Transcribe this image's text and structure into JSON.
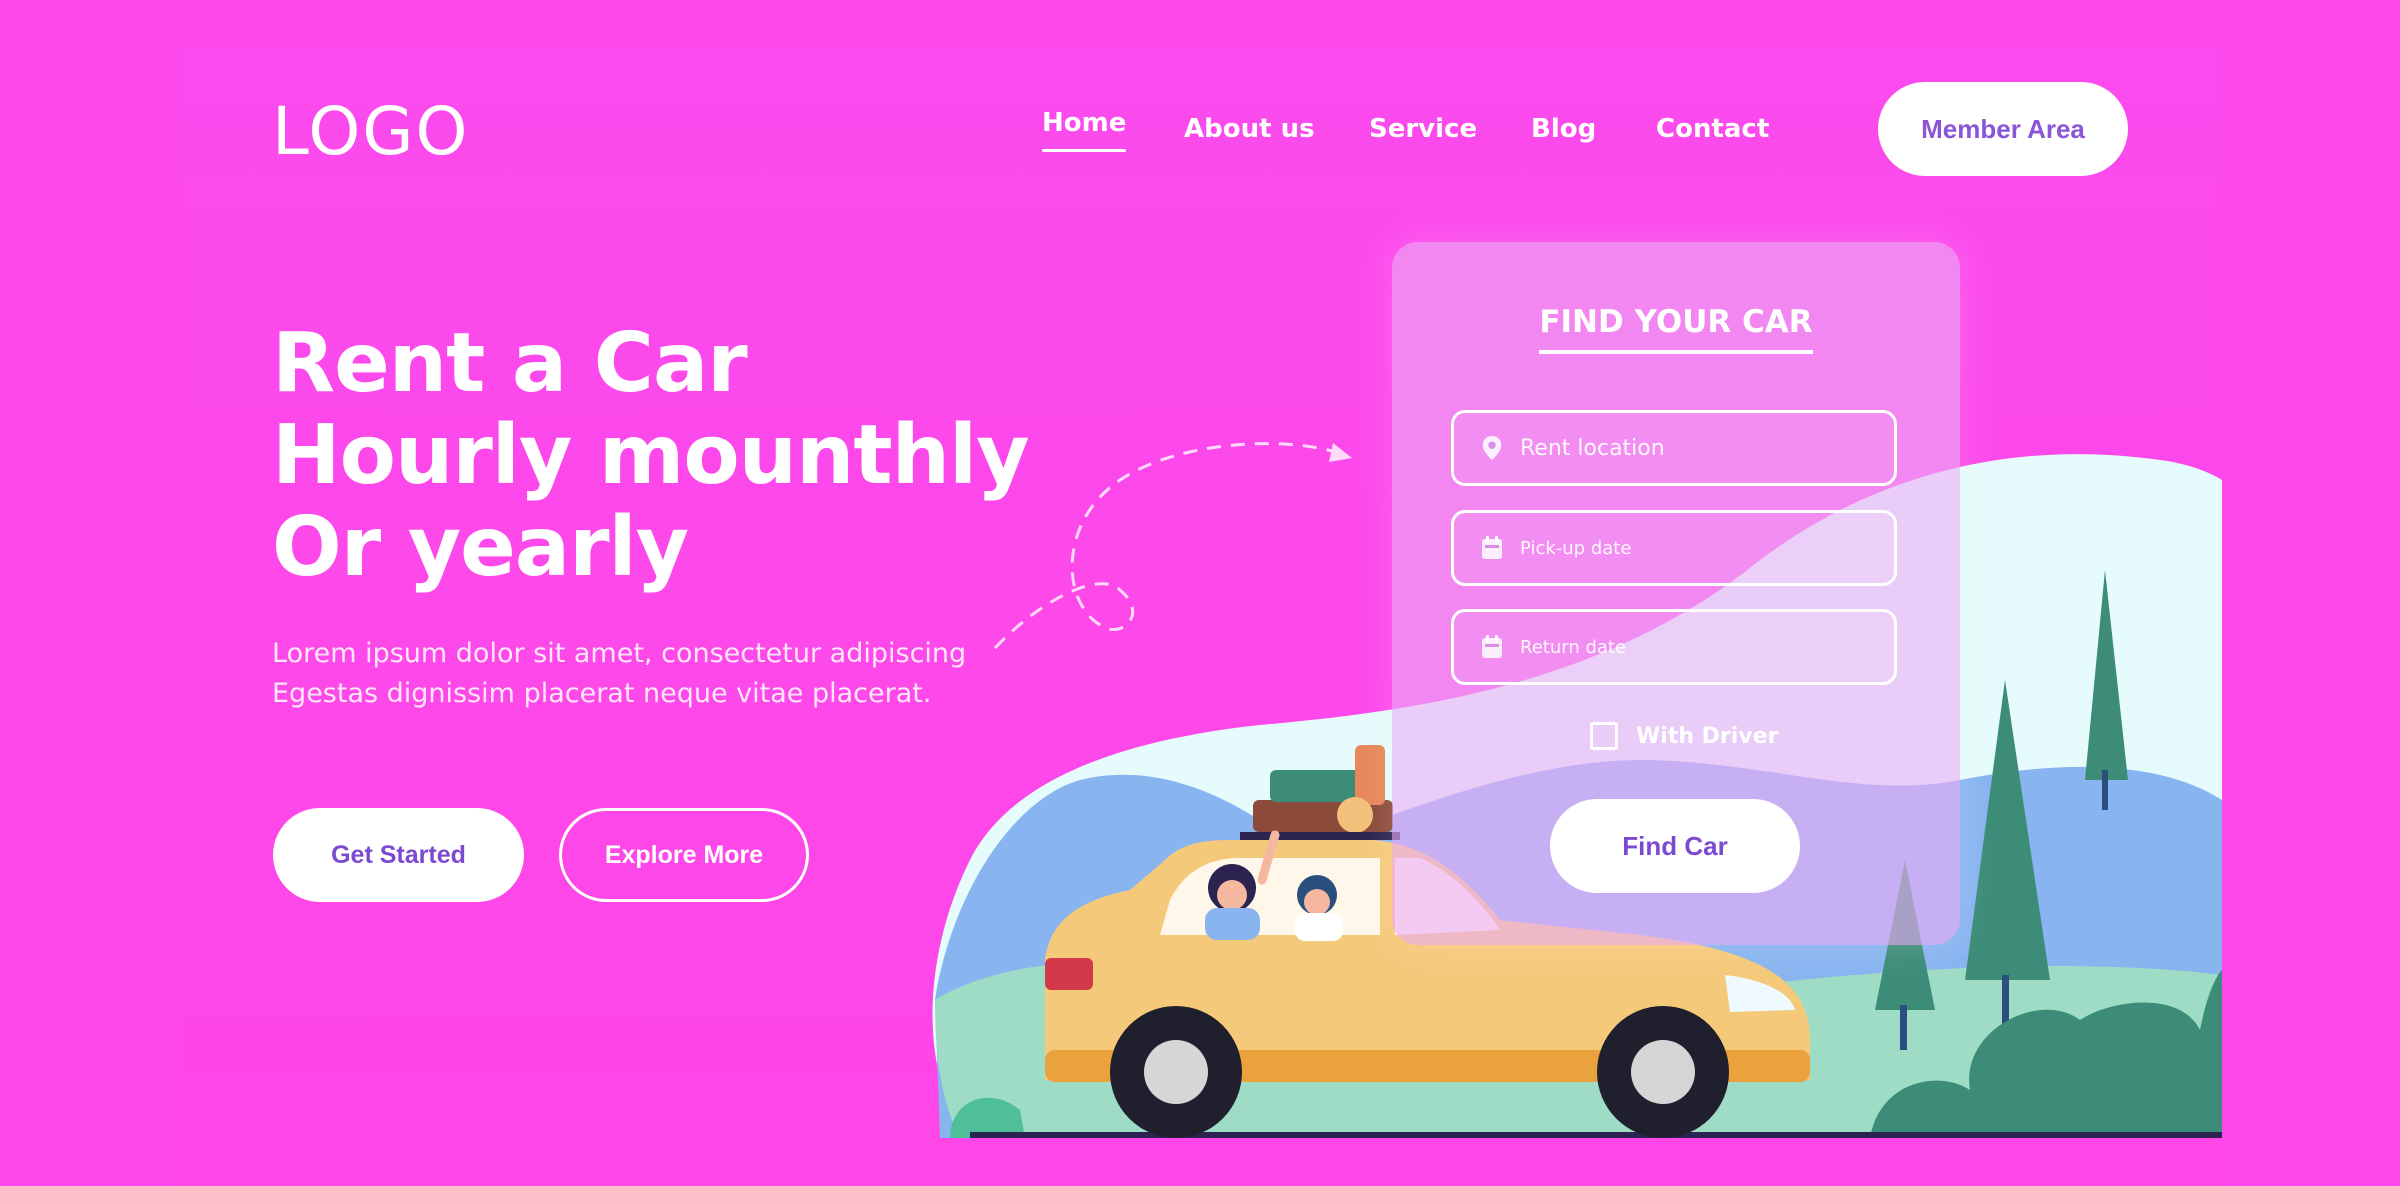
{
  "nav": {
    "logo": "LOGO",
    "items": [
      {
        "label": "Home",
        "active": true
      },
      {
        "label": "About us",
        "active": false
      },
      {
        "label": "Service",
        "active": false
      },
      {
        "label": "Blog",
        "active": false
      },
      {
        "label": "Contact",
        "active": false
      }
    ],
    "member_label": "Member Area"
  },
  "hero": {
    "title_lines": [
      "Rent a Car",
      "Hourly mounthly",
      "Or yearly"
    ],
    "subtitle_lines": [
      "Lorem ipsum dolor sit amet, consectetur adipiscing",
      "Egestas dignissim placerat neque vitae placerat."
    ],
    "primary_label": "Get Started",
    "secondary_label": "Explore More"
  },
  "form": {
    "title": "FIND YOUR CAR",
    "location_placeholder": "Rent location",
    "pickup_placeholder": "Pick-up date",
    "return_placeholder": "Return date",
    "driver_label": "With Driver",
    "driver_checked": false,
    "submit_label": "Find Car"
  },
  "colors": {
    "background": "#ff48e9",
    "button_text": "#7b4ad0",
    "car": "#f5c97a",
    "tree": "#3c8c78",
    "sky_hill": "#88b4f0"
  },
  "icons": {
    "location": "location-pin-icon",
    "calendar": "calendar-icon"
  }
}
